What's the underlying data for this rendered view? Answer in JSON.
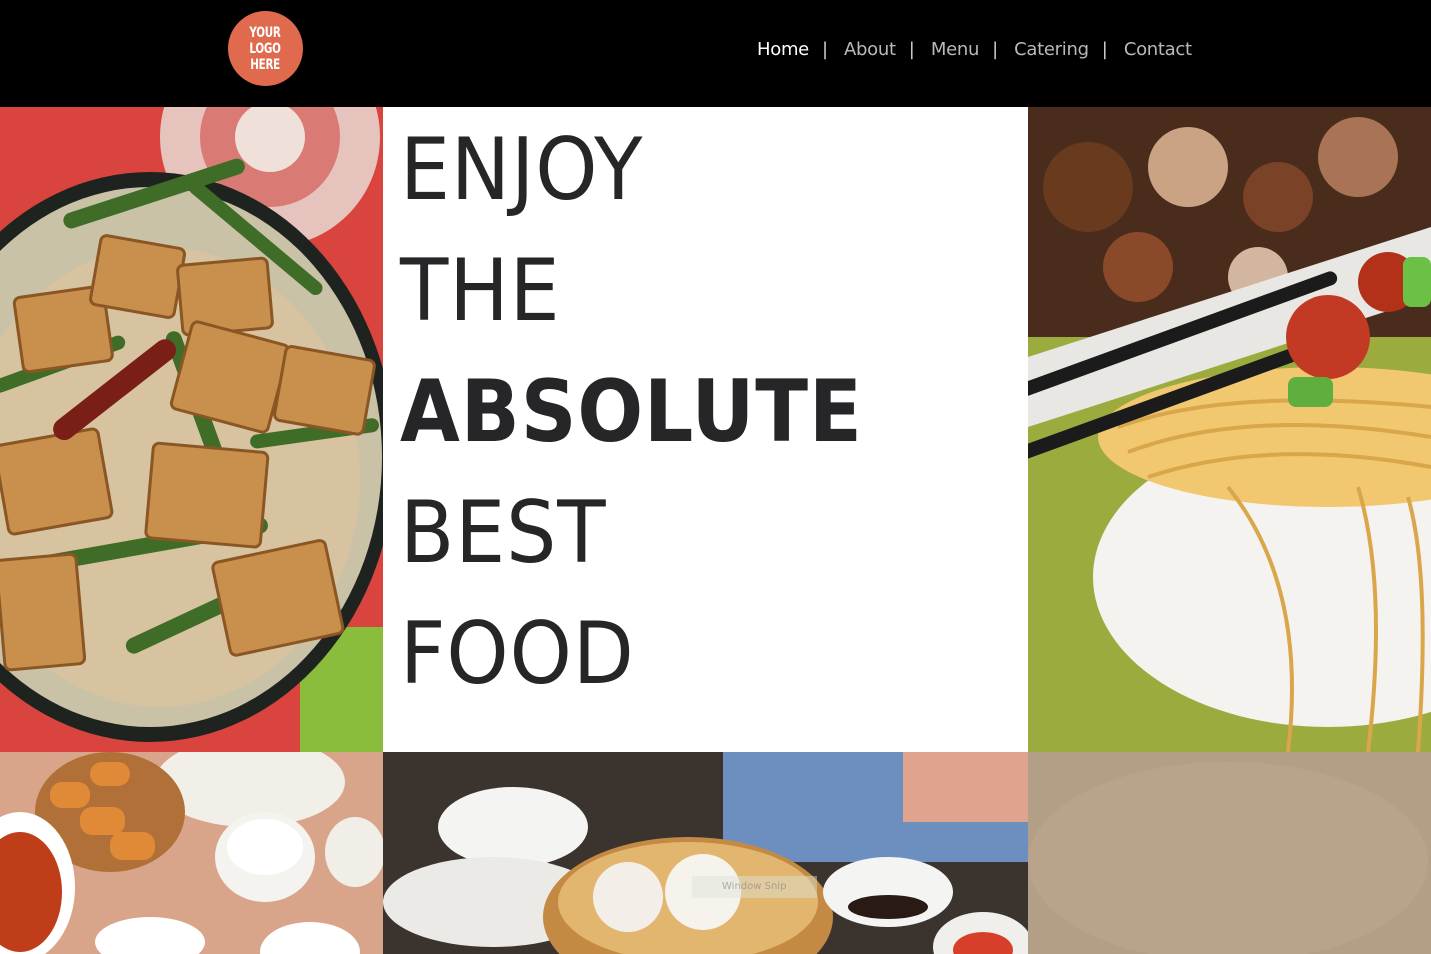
{
  "header": {
    "logo_lines": [
      "YOUR",
      "LOGO",
      "HERE"
    ],
    "logo_color": "#e06a4e",
    "nav": [
      {
        "label": "Home",
        "active": true
      },
      {
        "label": "About",
        "active": false
      },
      {
        "label": "Menu",
        "active": false
      },
      {
        "label": "Catering",
        "active": false
      },
      {
        "label": "Contact",
        "active": false
      }
    ],
    "separator": "|"
  },
  "hero": {
    "lines": [
      "ENJOY",
      "THE",
      "ABSOLUTE",
      "BEST",
      "FOOD"
    ]
  },
  "overlay": {
    "snip_label": "Window Snip"
  },
  "images": {
    "top_left": "tofu-green-beans-rice-plate",
    "top_right": "noodle-bowl-chopsticks",
    "bottom_left": "fried-dough-bowls-table",
    "bottom_center": "dim-sum-steamer-basket",
    "bottom_right": "beige-texture"
  }
}
